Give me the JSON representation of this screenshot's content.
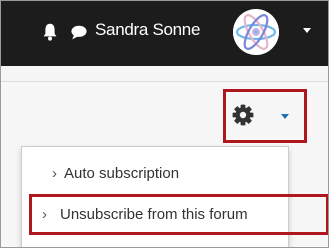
{
  "navbar": {
    "user_name": "Sandra Sonne",
    "bell_icon": "bell-icon",
    "chat_icon": "chat-bubble-icon",
    "avatar_icon": "atom-avatar",
    "background_color": "#1c1c1c"
  },
  "actions": {
    "gear_icon": "gear-icon",
    "caret_icon": "caret-down-icon",
    "highlight_color": "#b0161d"
  },
  "menu": {
    "items": [
      {
        "label": "Auto subscription",
        "chevron": "›"
      },
      {
        "label": "Unsubscribe from this forum",
        "chevron": "›"
      }
    ]
  }
}
